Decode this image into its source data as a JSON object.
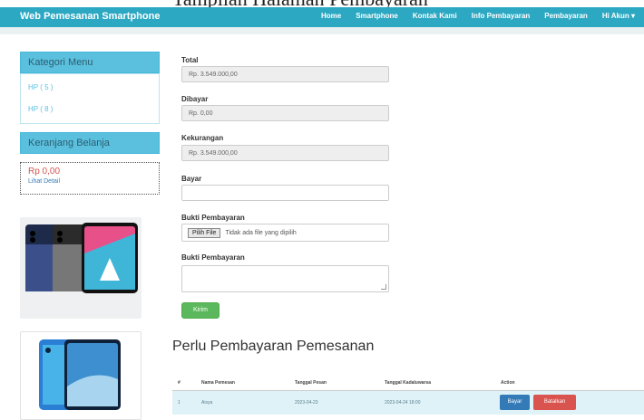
{
  "caption_fragment": "Tampilan Halaman Pembayaran",
  "navbar": {
    "brand": "Web Pemesanan Smartphone",
    "items": [
      "Home",
      "Smartphone",
      "Kontak Kami",
      "Info Pembayaran",
      "Pembayaran",
      "Hi Akun ▾"
    ]
  },
  "sidebar": {
    "menu_heading": "Kategori Menu",
    "categories": [
      "HP ( 5 )",
      "HP ( 8 )"
    ],
    "cart_heading": "Keranjang Belanja",
    "cart_amount": "Rp 0,00",
    "cart_link": "Lihat Detail"
  },
  "form": {
    "total_label": "Total",
    "total_value": "Rp. 3.549.000,00",
    "paid_label": "Dibayar",
    "paid_value": "Rp. 0,00",
    "shortfall_label": "Kekurangan",
    "shortfall_value": "Rp. 3.549.000,00",
    "pay_label": "Bayar",
    "pay_value": "",
    "proof_label": "Bukti Pembayaran",
    "file_button": "Pilih File",
    "file_status": "Tidak ada file yang dipilih",
    "note_label": "Bukti Pembayaran",
    "submit_label": "Kirim"
  },
  "orders": {
    "title": "Perlu Pembayaran Pemesanan",
    "columns": [
      "#",
      "Nama Pemesan",
      "Tanggal Pesan",
      "Tanggal Kadaluwarsa",
      "Action"
    ],
    "rows": [
      {
        "no": "1",
        "name": "Aisya",
        "order_date": "2023-04-23",
        "expiry_date": "2023-04-24 18:00",
        "pay_button": "Bayar",
        "cancel_button": "Batalkan"
      }
    ]
  },
  "colors": {
    "navbar": "#2ca8c2",
    "panel_heading": "#5bc0de",
    "submit": "#5cb85c",
    "pay": "#337ab7",
    "cancel": "#d9534f"
  }
}
